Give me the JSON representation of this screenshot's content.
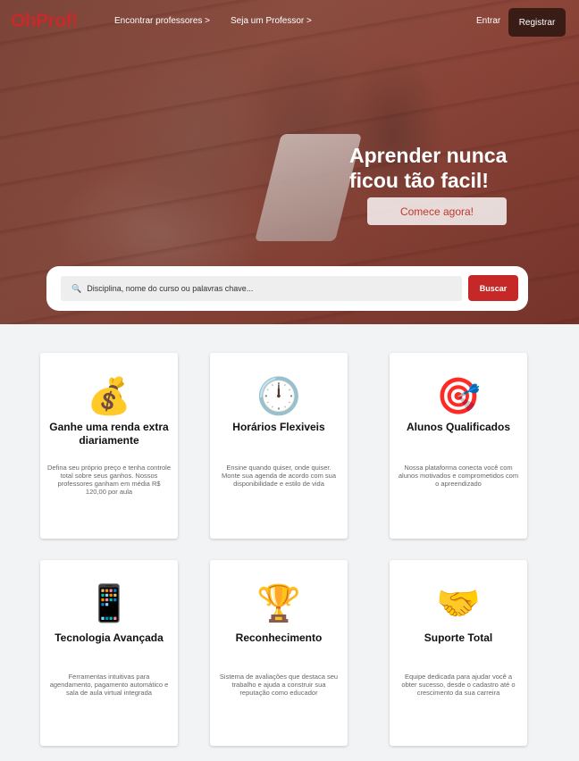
{
  "header": {
    "logo": "OhProf!",
    "nav": [
      {
        "label": "Encontrar professores >"
      },
      {
        "label": "Seja um Professor >"
      }
    ],
    "login_label": "Entrar",
    "register_label": "Registrar"
  },
  "hero": {
    "headline_line1": "Aprender nunca",
    "headline_line2": "ficou tão facil!",
    "cta_label": "Comece agora!"
  },
  "search": {
    "icon": "🔍",
    "placeholder": "Disciplina, nome do curso ou palavras chave...",
    "button_label": "Buscar"
  },
  "features": [
    {
      "icon": "money-bag-icon",
      "emoji": "💰",
      "title": "Ganhe uma renda extra diariamente",
      "description": "Defina seu próprio preço e tenha controle total sobre seus ganhos. Nossos professores ganham em média R$ 120,00 por aula"
    },
    {
      "icon": "clock-icon",
      "emoji": "🕛",
      "title": "Horários Flexiveis",
      "description": "Ensine quando quiser, onde quiser. Monte sua agenda de acordo com sua disponibilidade e estilo de vida"
    },
    {
      "icon": "target-icon",
      "emoji": "🎯",
      "title": "Alunos Qualificados",
      "description": "Nossa plataforma conecta você com alunos motivados e comprometidos com o apreendizado"
    },
    {
      "icon": "phone-icon",
      "emoji": "📱",
      "title": "Tecnologia Avançada",
      "description": "Ferramentas intuitivas para agendamento, pagamento automático e sala de aula virtual integrada"
    },
    {
      "icon": "trophy-icon",
      "emoji": "🏆",
      "title": "Reconhecimento",
      "description": "Sistema de avaliações que destaca seu trabalho e ajuda a construir sua reputação como educador"
    },
    {
      "icon": "handshake-icon",
      "emoji": "🤝",
      "title": "Suporte Total",
      "description": "Equipe dedicada para ajudar você a obter sucesso, desde o cadastro até o crescimento da sua carreira"
    }
  ]
}
